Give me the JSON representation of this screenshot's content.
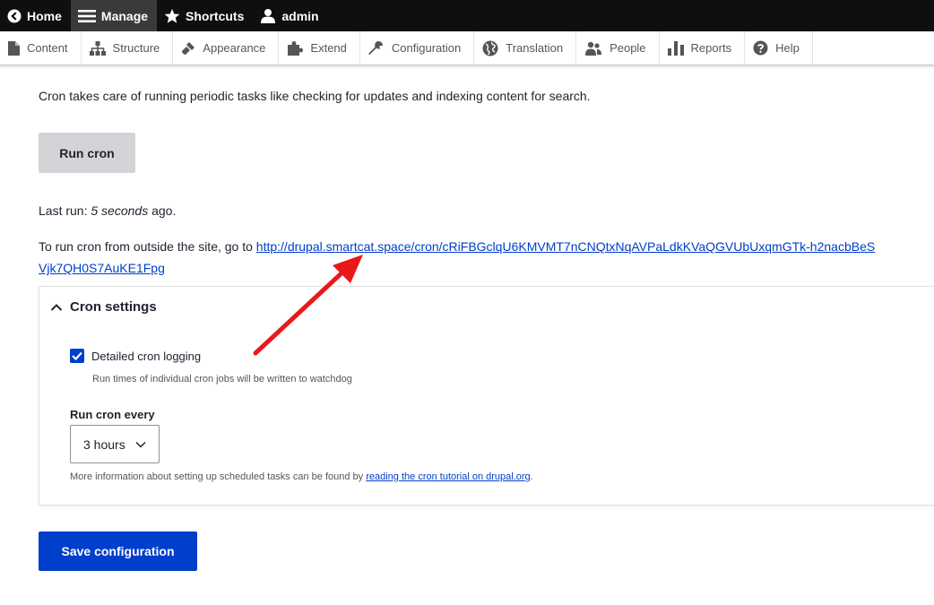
{
  "toolbar": {
    "items": [
      {
        "label": "Home",
        "icon": "home-chevron-icon"
      },
      {
        "label": "Manage",
        "icon": "menu-icon"
      },
      {
        "label": "Shortcuts",
        "icon": "star-icon"
      },
      {
        "label": "admin",
        "icon": "user-icon"
      }
    ]
  },
  "tray": {
    "items": [
      {
        "label": "Content",
        "icon": "document-icon"
      },
      {
        "label": "Structure",
        "icon": "structure-icon"
      },
      {
        "label": "Appearance",
        "icon": "brush-icon"
      },
      {
        "label": "Extend",
        "icon": "puzzle-icon"
      },
      {
        "label": "Configuration",
        "icon": "wrench-icon"
      },
      {
        "label": "Translation",
        "icon": "globe-icon"
      },
      {
        "label": "People",
        "icon": "people-icon"
      },
      {
        "label": "Reports",
        "icon": "bar-chart-icon"
      },
      {
        "label": "Help",
        "icon": "help-icon"
      }
    ]
  },
  "main": {
    "intro": "Cron takes care of running periodic tasks like checking for updates and indexing content for search.",
    "run_cron_label": "Run cron",
    "last_run_prefix": "Last run: ",
    "last_run_value": "5 seconds",
    "last_run_suffix": " ago.",
    "outside_prefix": "To run cron from outside the site, go to ",
    "cron_url": "http://drupal.smartcat.space/cron/cRiFBGclqU6KMVMT7nCNQtxNqAVPaLdkKVaQGVUbUxqmGTk-h2nacbBeSVjk7QH0S7AuKE1Fpg",
    "settings": {
      "title": "Cron settings",
      "logging_label": "Detailed cron logging",
      "logging_checked": true,
      "logging_desc": "Run times of individual cron jobs will be written to watchdog",
      "run_every_label": "Run cron every",
      "run_every_value": "3 hours",
      "more_info_prefix": "More information about setting up scheduled tasks can be found by ",
      "more_info_link": "reading the cron tutorial on drupal.org",
      "more_info_suffix": "."
    },
    "save_label": "Save configuration"
  },
  "colors": {
    "accent": "#003ecc",
    "toolbar_bg": "#0f0f0f",
    "annotation_arrow": "#e8181b"
  }
}
